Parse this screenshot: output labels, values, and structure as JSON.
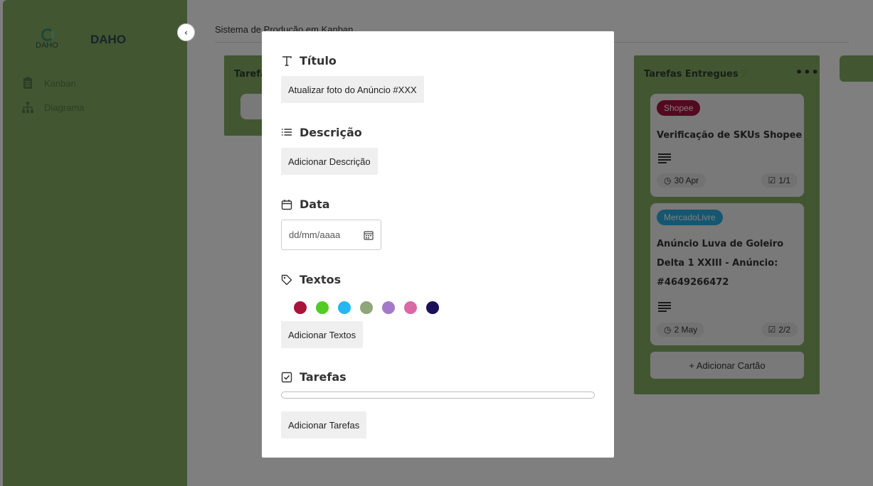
{
  "sidebar": {
    "brand_name": "DAHO",
    "logo_text": "DAHO",
    "items": [
      {
        "label": "Kanban",
        "icon": "clipboard-icon"
      },
      {
        "label": "Diagrama",
        "icon": "sitemap-icon"
      }
    ]
  },
  "main": {
    "title": "Sistema de Produção em Kanban"
  },
  "columns": [
    {
      "title": "Tarefas"
    },
    {
      "title": "Tarefas Entregues",
      "count": "2"
    }
  ],
  "cards": [
    {
      "badge": "Shopee",
      "badge_color": "#a8143c",
      "title": "Verificação de SKUs Shopee",
      "date": "30 Apr",
      "tasks": "1/1"
    },
    {
      "badge": "MercadoLivre",
      "badge_color": "#2aaee0",
      "title_lines": [
        "Anúncio Luva de Goleiro",
        "Delta 1 XXIII - Anúncio:",
        "#4649266472"
      ],
      "date": "2 May",
      "tasks": "2/2"
    }
  ],
  "add_card_label": "+ Adicionar Cartão",
  "modal": {
    "title_label": "Título",
    "title_value": "Atualizar foto do Anúncio #XXX",
    "description_label": "Descrição",
    "description_button": "Adicionar Descrição",
    "date_label": "Data",
    "date_placeholder": "dd/mm/aaaa",
    "texts_label": "Textos",
    "colors": [
      "#a8143c",
      "#52cc22",
      "#22b8f0",
      "#8fa57a",
      "#a37ac8",
      "#d868a8",
      "#1e0f5a"
    ],
    "texts_button": "Adicionar Textos",
    "tasks_label": "Tarefas",
    "tasks_progress": 0,
    "tasks_button": "Adicionar Tarefas"
  }
}
